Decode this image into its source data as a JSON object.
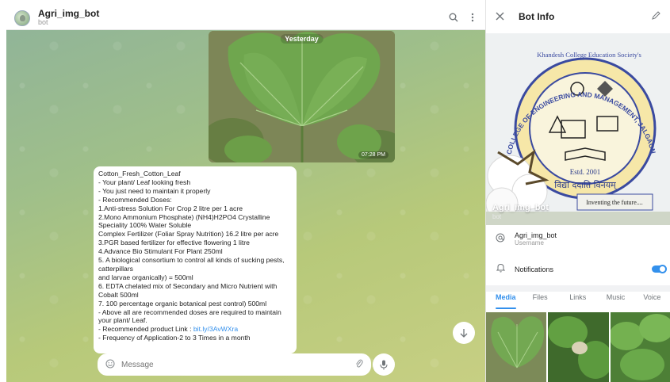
{
  "chat": {
    "title": "Agri_img_bot",
    "subtitle": "bot",
    "photo": {
      "date_label": "Yesterday",
      "time_label": "07:28 PM"
    },
    "message_lines": [
      "Cotton_Fresh_Cotton_Leaf",
      "- Your plant/ Leaf looking fresh",
      "- You just need to maintain it properly",
      "- Recommended Doses:",
      "1.Anti-stress Solution For Crop 2 litre per 1 acre",
      "2.Mono Ammonium Phosphate) (NH4)H2PO4 Crystalline",
      "Speciality 100% Water Soluble",
      "Complex Fertilizer (Foliar Spray Nutrition) 16.2 litre per acre",
      "3.PGR based fertilizer for effective flowering 1 litre",
      "4.Advance Bio Stimulant For Plant 250ml",
      "5. A biological consortium to control all kinds of sucking pests,",
      "catterpillars",
      "and larvae organically) = 500ml",
      "6. EDTA chelated mix of Secondary and Micro Nutrient with",
      "Cobalt 500ml",
      "7. 100 percentage organic botanical pest control) 500ml",
      "- Above all are recommended doses are required to maintain",
      "your plant/ Leaf."
    ],
    "link_prefix": "- Recommended product Link : ",
    "link_text": "bit.ly/3AvWXra",
    "last_line": "- Frequency of Application-2 to 3 Times in a month",
    "composer_placeholder": "Message"
  },
  "panel": {
    "title": "Bot Info",
    "profile_name": "Agri_img_bot",
    "profile_sub": "bot",
    "logo_text_top": "Khandesh College Education Society's",
    "logo_text_ring": "COLLEGE OF ENGINEERING AND MANAGEMENT, JALGAON",
    "logo_estd": "Estd. 2001",
    "logo_motto": "विद्या ददाति विनयम्",
    "logo_tagline": "Inventing the future....",
    "username_value": "Agri_img_bot",
    "username_label": "Username",
    "notifications_label": "Notifications",
    "notifications_on": true,
    "tabs": [
      "Media",
      "Files",
      "Links",
      "Music",
      "Voice"
    ],
    "active_tab": "Media"
  },
  "colors": {
    "accent": "#3390ec",
    "chat_bg": "#9fbf8a"
  },
  "icons": {
    "search": "search-icon",
    "more": "more-vertical-icon",
    "close": "close-icon",
    "edit": "pencil-icon",
    "username": "at-icon",
    "notifications": "bell-icon",
    "emoji": "smile-icon",
    "attach": "paperclip-icon",
    "mic": "microphone-icon",
    "scroll_down": "arrow-down-icon"
  }
}
